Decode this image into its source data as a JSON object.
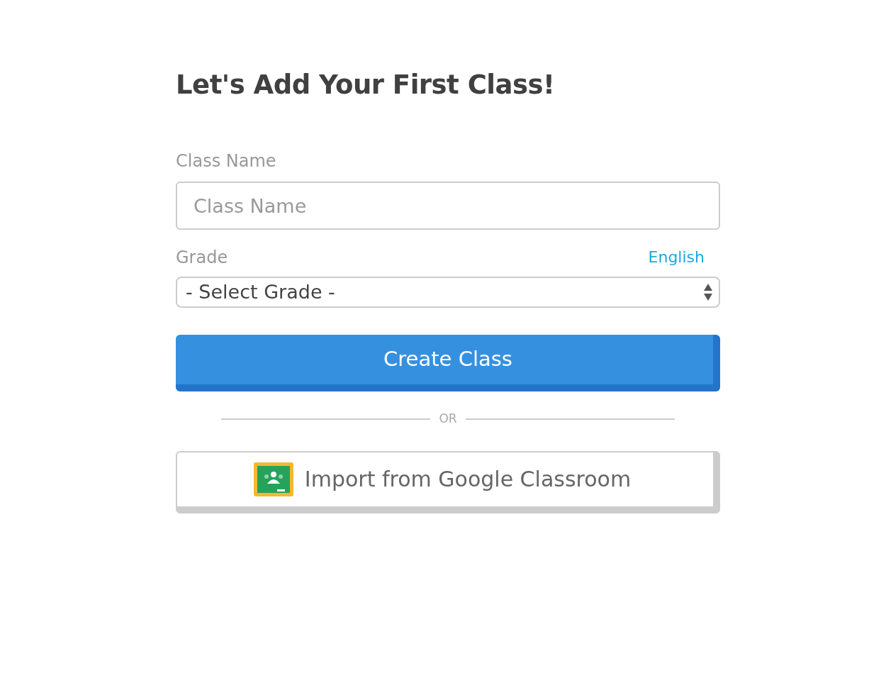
{
  "title": "Let's Add Your First Class!",
  "class_name": {
    "label": "Class Name",
    "placeholder": "Class Name"
  },
  "grade": {
    "label": "Grade",
    "language_link": "English",
    "value": "- Select Grade -"
  },
  "create_button": "Create Class",
  "divider": "OR",
  "import_button": "Import from Google Classroom"
}
